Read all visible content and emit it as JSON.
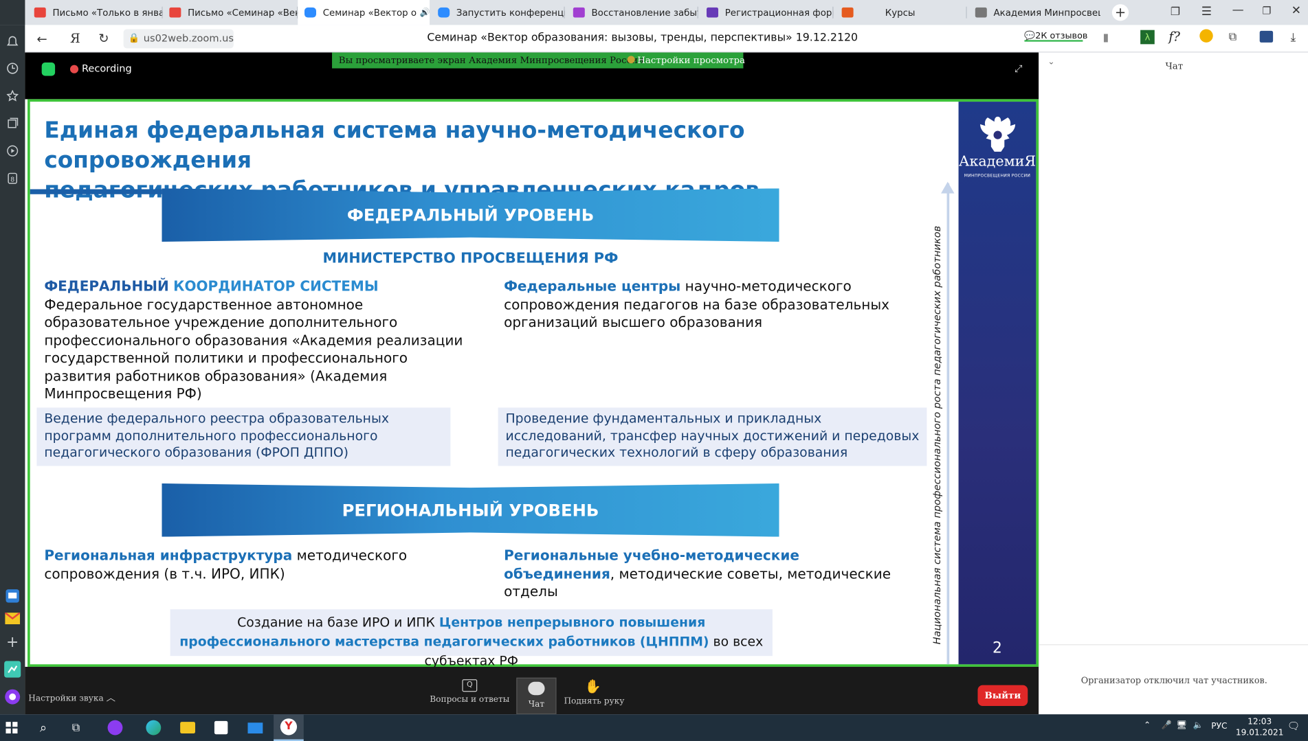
{
  "browser": {
    "tabs": [
      {
        "label": "Письмо «Только в январ",
        "icon": "gmail-icon",
        "color": "#e8453c"
      },
      {
        "label": "Письмо «Семинар «Вект",
        "icon": "gmail-icon",
        "color": "#e8453c"
      },
      {
        "label": "Семинар «Вектор о",
        "icon": "zoom-icon",
        "color": "#2d8cff"
      },
      {
        "label": "Запустить конференцию",
        "icon": "zoom-icon",
        "color": "#2d8cff"
      },
      {
        "label": "Восстановление забытог",
        "icon": "feather-icon",
        "color": "#a13fd1"
      },
      {
        "label": "Регистрационная форма",
        "icon": "form-icon",
        "color": "#673ab7"
      },
      {
        "label": "Курсы",
        "icon": "book-icon",
        "color": "#e55b1f"
      },
      {
        "label": "Академия Минпросвеще",
        "icon": "academy-icon",
        "color": "#555555"
      }
    ],
    "url": "us02web.zoom.us",
    "page_title": "Семинар «Вектор образования: вызовы, тренды, перспективы» 19.12.2120",
    "reviews": "2К отзывов"
  },
  "zoom": {
    "recording": "Recording",
    "share_banner": "Вы просматриваете экран Академия Минпросвещения России",
    "view_settings": "Настройки просмотра",
    "audio_settings": "Настройки звука",
    "buttons": {
      "qa": "Вопросы и ответы",
      "chat": "Чат",
      "raise_hand": "Поднять руку"
    },
    "leave": "Выйти",
    "chat_panel": {
      "title": "Чат",
      "notice": "Организатор отключил чат участников."
    }
  },
  "slide": {
    "title_line1": "Единая федеральная система научно-методического сопровождения",
    "title_line2": "педагогических работников и управленческих кадров",
    "federal_level": "ФЕДЕРАЛЬНЫЙ УРОВЕНЬ",
    "ministry": "МИНИСТЕРСТВО ПРОСВЕЩЕНИЯ РФ",
    "left_heading_1": "ФЕДЕРАЛЬНЫЙ",
    "left_heading_2": "КООРДИНАТОР СИСТЕМЫ",
    "left_body": "Федеральное государственное автономное образовательное учреждение дополнительного профессионального образования «Академия реализации государственной политики и профессионального развития работников образования» (Академия Минпросвещения РФ)",
    "right_heading": "Федеральные центры",
    "right_body": " научно-методического сопровождения педагогов на базе образовательных организаций высшего образования",
    "box_left": "Ведение федерального реестра образовательных программ дополнительного профессионального педагогического образования (ФРОП ДППО)",
    "box_right": "Проведение фундаментальных и прикладных исследований, трансфер научных достижений и передовых педагогических технологий в сферу образования",
    "regional_level": "РЕГИОНАЛЬНЫЙ УРОВЕНЬ",
    "reg_left_heading": "Региональная инфраструктура",
    "reg_left_body": " методического сопровождения (в т.ч. ИРО, ИПК)",
    "reg_right_heading": "Региональные учебно-методические объединения",
    "reg_right_body": ", методические советы, методические отделы",
    "bottom_pre": "Создание на базе ИРО и ИПК ",
    "bottom_hl": "Центров непрерывного повышения профессионального мастерства педагогических работников (ЦНППМ)",
    "bottom_post": " во всех субъектах РФ",
    "vertical": "Национальная система профессионального роста педагогических работников",
    "logo_text": "АкадемиЯ",
    "logo_sub": "МИНПРОСВЕЩЕНИЯ РОССИИ",
    "page_number": "2"
  },
  "taskbar": {
    "lang": "РУС",
    "time": "12:03",
    "date": "19.01.2021"
  }
}
